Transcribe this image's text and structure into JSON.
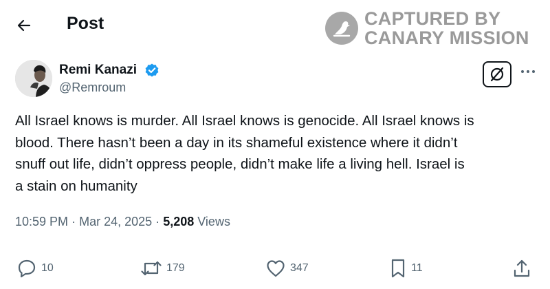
{
  "header": {
    "title": "Post"
  },
  "watermark": {
    "line1": "CAPTURED BY",
    "line2": "CANARY MISSION",
    "color": "#9a9a9a"
  },
  "user": {
    "name": "Remi Kanazi",
    "handle": "@Remroum",
    "verified": true,
    "verified_color": "#1d9bf0"
  },
  "post": {
    "lines": [
      "All Israel knows is murder. All Israel knows is genocide. All Israel knows is",
      "blood. There hasn’t been a day in its shameful existence where it didn’t",
      "snuff out life, didn’t oppress people, didn’t make life a living hell. Israel is",
      "a stain on humanity"
    ],
    "time": "10:59 PM",
    "separator": "·",
    "date": "Mar 24, 2025",
    "views_count": "5,208",
    "views_label": "Views"
  },
  "actions": {
    "replies": "10",
    "reposts": "179",
    "likes": "347",
    "bookmarks": "11"
  },
  "icons": [
    "back-arrow-icon",
    "canary-logo-icon",
    "verified-badge-icon",
    "grok-icon",
    "more-icon",
    "reply-icon",
    "repost-icon",
    "like-icon",
    "bookmark-icon",
    "share-icon"
  ]
}
